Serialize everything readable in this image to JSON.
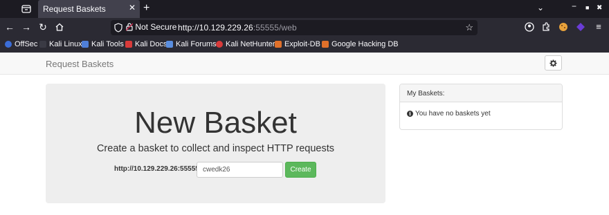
{
  "browser": {
    "tab_title": "Request Baskets",
    "tab_close": "✕",
    "new_tab": "+",
    "not_secure": "Not Secure",
    "url_host": "http://10.129.229.26",
    "url_rest": ":55555/web",
    "bookmarks": [
      "OffSec",
      "Kali Linux",
      "Kali Tools",
      "Kali Docs",
      "Kali Forums",
      "Kali NetHunter",
      "Exploit-DB",
      "Google Hacking DB"
    ]
  },
  "page": {
    "brand": "Request Baskets",
    "jumbotron": {
      "title": "New Basket",
      "subtitle": "Create a basket to collect and inspect HTTP requests",
      "prefix": "http://10.129.229.26:55555/",
      "basket_name": "cwedk26",
      "create_label": "Create"
    },
    "panel": {
      "heading": "My Baskets:",
      "empty_text": "You have no baskets yet"
    }
  },
  "colors": {
    "create_green": "#5cb85c",
    "jumbotron_bg": "#eeeeee",
    "chrome_dark": "#2b2a33"
  }
}
